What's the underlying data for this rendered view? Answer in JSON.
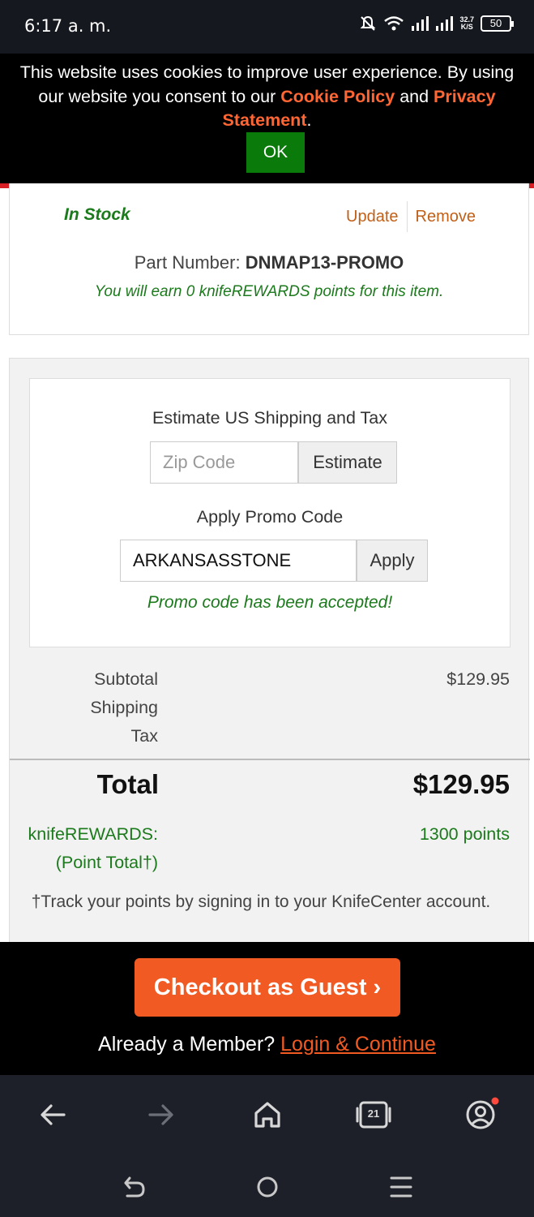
{
  "status_bar": {
    "time": "6:17 a. m.",
    "net_speed_value": "32.7",
    "net_speed_unit": "K/S",
    "battery": "50"
  },
  "cookie_banner": {
    "text_before": "This website uses cookies to improve user experience. By using our website you consent to our ",
    "cookie_policy_link": "Cookie Policy",
    "text_and": " and ",
    "privacy_link": "Privacy Statement",
    "text_end": ".",
    "ok_label": "OK"
  },
  "item": {
    "stock_status": "In Stock",
    "update_label": "Update",
    "remove_label": "Remove",
    "part_number_label": "Part Number:",
    "part_number": "DNMAP13-PROMO",
    "earn_text": "You will earn 0 knifeREWARDS points for this item."
  },
  "estimate": {
    "heading": "Estimate US Shipping and Tax",
    "zip_placeholder": "Zip Code",
    "estimate_button": "Estimate"
  },
  "promo": {
    "heading": "Apply Promo Code",
    "code_value": "ARKANSASSTONE",
    "apply_button": "Apply",
    "accepted_message": "Promo code has been accepted!"
  },
  "summary": {
    "subtotal_label": "Subtotal",
    "subtotal_value": "$129.95",
    "shipping_label": "Shipping",
    "tax_label": "Tax",
    "total_label": "Total",
    "total_value": "$129.95",
    "rewards_label": "knifeREWARDS:",
    "rewards_sublabel": "(Point Total†)",
    "rewards_value": "1300 points",
    "note": "†Track your points by signing in to your KnifeCenter account."
  },
  "checkout": {
    "guest_button": "Checkout as Guest ›",
    "member_prompt": "Already a Member? ",
    "login_link": "Login & Continue"
  },
  "browser": {
    "tab_count": "21"
  },
  "colors": {
    "accent_orange": "#f15a22",
    "success_green": "#1b7a1b",
    "ok_green": "#0a7a0a",
    "banner_red": "#d81f26"
  }
}
